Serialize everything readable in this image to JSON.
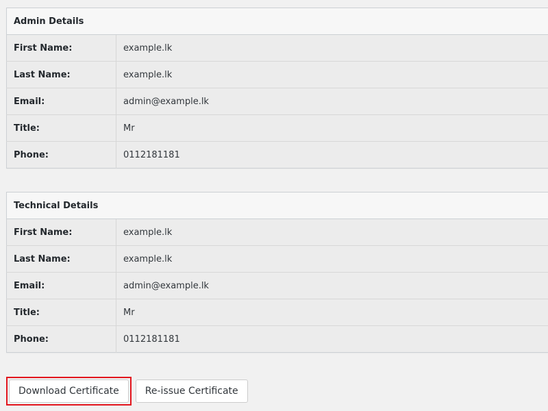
{
  "admin_details": {
    "header": "Admin Details",
    "rows": [
      {
        "label": "First Name:",
        "value": "example.lk"
      },
      {
        "label": "Last Name:",
        "value": "example.lk"
      },
      {
        "label": "Email:",
        "value": "admin@example.lk"
      },
      {
        "label": "Title:",
        "value": "Mr"
      },
      {
        "label": "Phone:",
        "value": "0112181181"
      }
    ]
  },
  "technical_details": {
    "header": "Technical Details",
    "rows": [
      {
        "label": "First Name:",
        "value": "example.lk"
      },
      {
        "label": "Last Name:",
        "value": "example.lk"
      },
      {
        "label": "Email:",
        "value": "admin@example.lk"
      },
      {
        "label": "Title:",
        "value": "Mr"
      },
      {
        "label": "Phone:",
        "value": "0112181181"
      }
    ]
  },
  "actions": {
    "download_label": "Download Certificate",
    "reissue_label": "Re-issue Certificate"
  },
  "colors": {
    "highlight": "#e2141c",
    "header_bg": "#f7f7f7",
    "row_bg": "#ececec",
    "border": "#ccd0d4"
  }
}
